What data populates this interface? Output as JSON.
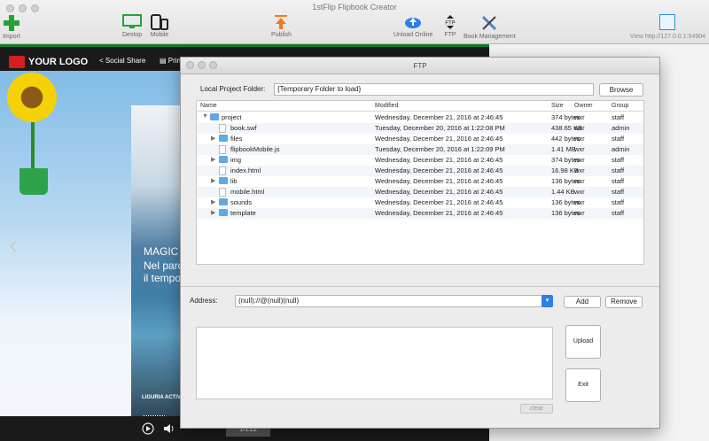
{
  "app": {
    "title": "1stFlip Flipbook Creator",
    "view_url": "View http://127.0.0.1:54904"
  },
  "toolbar": {
    "import": "Import",
    "desktop": "Destop",
    "mobile": "Mobile",
    "publish": "Publish",
    "upload_online": "Unload Online",
    "ftp": "FTP",
    "book_management": "Book Management"
  },
  "preview": {
    "logo": "YOUR LOGO",
    "social_share": "Social Share",
    "print": "Print",
    "cover_magic": "MAGIC",
    "cover_sub1": "Nel parc",
    "cover_sub2": "il tempo",
    "cover_liguria": "LIGURIA ACTIV",
    "page_indicator": "1/212"
  },
  "ftp": {
    "window_title": "FTP",
    "local_folder_label": "Local Project Folder:",
    "local_folder_value": "{Temporary Folder to load}",
    "browse": "Browse",
    "columns": {
      "name": "Name",
      "modified": "Modified",
      "size": "Size",
      "owner": "Owner",
      "group": "Group"
    },
    "files": [
      {
        "name": "project",
        "kind": "folder",
        "toggle": "▼",
        "modified": "Wednesday, December 21, 2016 at 2:46:45",
        "size": "374 bytes",
        "owner": "wxr",
        "group": "staff"
      },
      {
        "name": "book.swf",
        "kind": "file",
        "toggle": "",
        "modified": "Tuesday, December 20, 2016 at 1:22:08 PM",
        "size": "438.65 KB",
        "owner": "wxr",
        "group": "admin"
      },
      {
        "name": "files",
        "kind": "folder",
        "toggle": "▶",
        "modified": "Wednesday, December 21, 2016 at 2:46:45",
        "size": "442 bytes",
        "owner": "wxr",
        "group": "staff"
      },
      {
        "name": "flipbookMobile.js",
        "kind": "file",
        "toggle": "",
        "modified": "Tuesday, December 20, 2016 at 1:22:09 PM",
        "size": "1.41 MB",
        "owner": "wxr",
        "group": "admin"
      },
      {
        "name": "img",
        "kind": "folder",
        "toggle": "▶",
        "modified": "Wednesday, December 21, 2016 at 2:46:45",
        "size": "374 bytes",
        "owner": "wxr",
        "group": "staff"
      },
      {
        "name": "index.html",
        "kind": "file",
        "toggle": "",
        "modified": "Wednesday, December 21, 2016 at 2:46:45",
        "size": "16.98 KB",
        "owner": "wxr",
        "group": "staff"
      },
      {
        "name": "lib",
        "kind": "folder",
        "toggle": "▶",
        "modified": "Wednesday, December 21, 2016 at 2:46:45",
        "size": "136 bytes",
        "owner": "wxr",
        "group": "staff"
      },
      {
        "name": "mobile.html",
        "kind": "file",
        "toggle": "",
        "modified": "Wednesday, December 21, 2016 at 2:46:45",
        "size": "1.44 KB",
        "owner": "wxr",
        "group": "staff"
      },
      {
        "name": "sounds",
        "kind": "folder",
        "toggle": "▶",
        "modified": "Wednesday, December 21, 2016 at 2:46:45",
        "size": "136 bytes",
        "owner": "wxr",
        "group": "staff"
      },
      {
        "name": "template",
        "kind": "folder",
        "toggle": "▶",
        "modified": "Wednesday, December 21, 2016 at 2:46:45",
        "size": "136 bytes",
        "owner": "wxr",
        "group": "staff"
      }
    ],
    "address_label": "Address:",
    "address_value": "(null)://@(null)(null)",
    "add": "Add",
    "remove": "Remove",
    "upload": "Upload",
    "exit": "Exit",
    "clear": "clear"
  },
  "colors": {
    "accent": "#2f7ee6",
    "folder": "#61a8e8",
    "import_green": "#23a33a",
    "publish_orange": "#f07a24"
  }
}
